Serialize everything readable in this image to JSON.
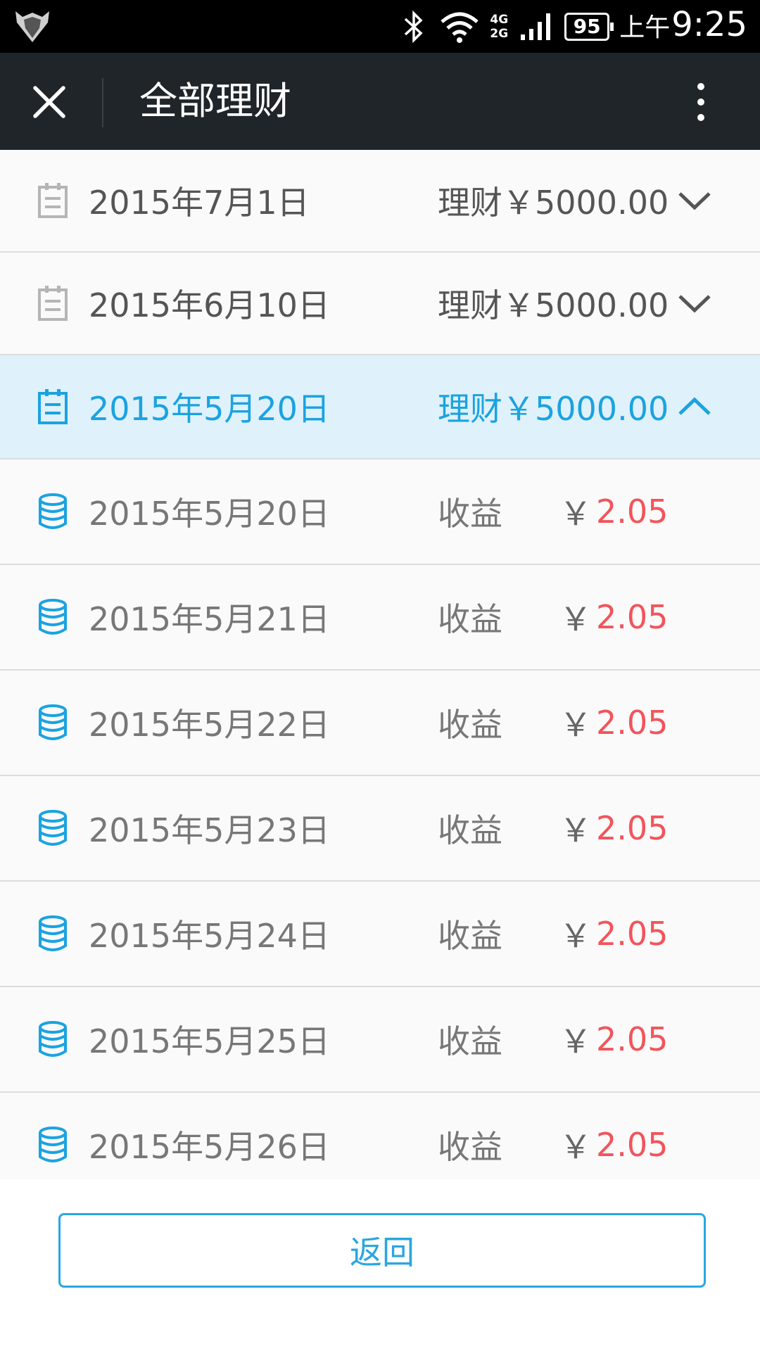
{
  "status_bar": {
    "network_top": "4G",
    "network_bottom": "2G",
    "battery": "95",
    "ampm": "上午",
    "time": "9:25"
  },
  "titlebar": {
    "title": "全部理财",
    "close_icon": "close-icon",
    "more_icon": "more-vertical-icon"
  },
  "colors": {
    "accent": "#1aa3e0",
    "income_value": "#f2545b",
    "titlebar_bg": "#1f2529",
    "expanded_row_bg": "#dff1fb"
  },
  "records": [
    {
      "date": "2015年7月1日",
      "amount": "理财￥5000.00",
      "expanded": false
    },
    {
      "date": "2015年6月10日",
      "amount": "理财￥5000.00",
      "expanded": false
    },
    {
      "date": "2015年5月20日",
      "amount": "理财￥5000.00",
      "expanded": true
    }
  ],
  "income_rows": [
    {
      "date": "2015年5月20日",
      "label": "收益",
      "currency": "￥",
      "value": "2.05"
    },
    {
      "date": "2015年5月21日",
      "label": "收益",
      "currency": "￥",
      "value": "2.05"
    },
    {
      "date": "2015年5月22日",
      "label": "收益",
      "currency": "￥",
      "value": "2.05"
    },
    {
      "date": "2015年5月23日",
      "label": "收益",
      "currency": "￥",
      "value": "2.05"
    },
    {
      "date": "2015年5月24日",
      "label": "收益",
      "currency": "￥",
      "value": "2.05"
    },
    {
      "date": "2015年5月25日",
      "label": "收益",
      "currency": "￥",
      "value": "2.05"
    },
    {
      "date": "2015年5月26日",
      "label": "收益",
      "currency": "￥",
      "value": "2.05"
    }
  ],
  "footer": {
    "back_label": "返回"
  }
}
